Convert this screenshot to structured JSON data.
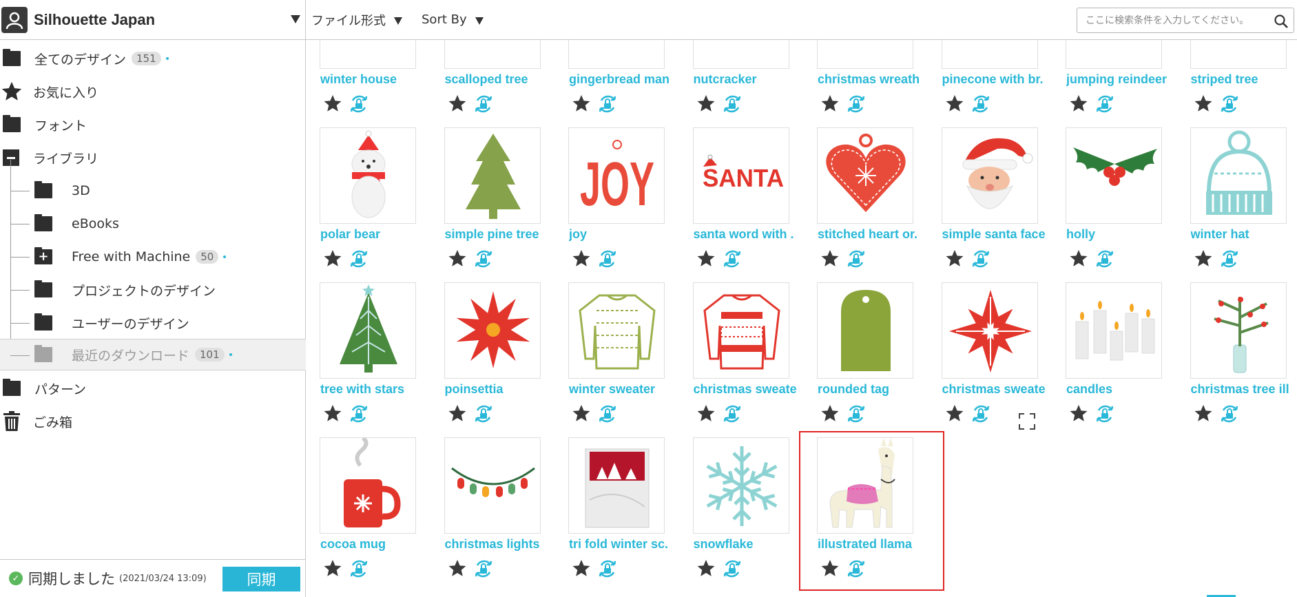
{
  "account": {
    "name": "Silhouette Japan"
  },
  "nav": {
    "all_designs": "全てのデザイン",
    "all_designs_count": "151",
    "favorites": "お気に入り",
    "fonts": "フォント",
    "library": "ライブラリ",
    "sub_3d": "3D",
    "sub_ebooks": "eBooks",
    "sub_free": "Free with Machine",
    "sub_free_count": "50",
    "sub_project": "プロジェクトのデザイン",
    "sub_user": "ユーザーのデザイン",
    "sub_recent": "最近のダウンロード",
    "sub_recent_count": "101",
    "patterns": "パターン",
    "trash": "ごみ箱"
  },
  "sync": {
    "status": "同期しました",
    "timestamp": "(2021/03/24 13:09)",
    "button": "同期"
  },
  "toolbar": {
    "file_format": "ファイル形式",
    "sort_by": "Sort By",
    "search_placeholder": "ここに検索条件を入力してください。"
  },
  "colors": {
    "accent": "#29b8d8",
    "highlight": "#e02424"
  },
  "designs": [
    {
      "title": "winter house",
      "icon": "winter-house-icon"
    },
    {
      "title": "scalloped tree",
      "icon": "scalloped-tree-icon"
    },
    {
      "title": "gingerbread man",
      "icon": "gingerbread-man-icon"
    },
    {
      "title": "nutcracker",
      "icon": "nutcracker-icon"
    },
    {
      "title": "christmas wreath",
      "icon": "wreath-icon"
    },
    {
      "title": "pinecone with br.",
      "icon": "pinecone-icon"
    },
    {
      "title": "jumping reindeer",
      "icon": "reindeer-icon"
    },
    {
      "title": "striped tree",
      "icon": "striped-tree-icon"
    },
    {
      "title": "polar bear",
      "icon": "polar-bear-icon"
    },
    {
      "title": "simple pine tree",
      "icon": "pine-tree-icon"
    },
    {
      "title": "joy",
      "icon": "joy-icon",
      "text": "JOY"
    },
    {
      "title": "santa word with .",
      "icon": "santa-word-icon",
      "text": "SANTA"
    },
    {
      "title": "stitched heart or.",
      "icon": "heart-ornament-icon"
    },
    {
      "title": "simple santa face",
      "icon": "santa-face-icon"
    },
    {
      "title": "holly",
      "icon": "holly-icon"
    },
    {
      "title": "winter hat",
      "icon": "winter-hat-icon"
    },
    {
      "title": "tree with stars",
      "icon": "star-tree-icon"
    },
    {
      "title": "poinsettia",
      "icon": "poinsettia-icon"
    },
    {
      "title": "winter sweater",
      "icon": "sweater-icon"
    },
    {
      "title": "christmas sweate",
      "icon": "red-sweater-icon"
    },
    {
      "title": "rounded tag",
      "icon": "tag-icon"
    },
    {
      "title": "christmas sweate",
      "icon": "snowflake-pattern-icon"
    },
    {
      "title": "candles",
      "icon": "candles-icon"
    },
    {
      "title": "christmas tree ill",
      "icon": "tree-branch-icon"
    },
    {
      "title": "cocoa mug",
      "icon": "mug-icon"
    },
    {
      "title": "christmas lights",
      "icon": "lights-icon"
    },
    {
      "title": "tri fold winter sc.",
      "icon": "trifold-card-icon"
    },
    {
      "title": "snowflake",
      "icon": "snowflake-icon"
    },
    {
      "title": "illustrated llama",
      "icon": "llama-icon"
    }
  ]
}
